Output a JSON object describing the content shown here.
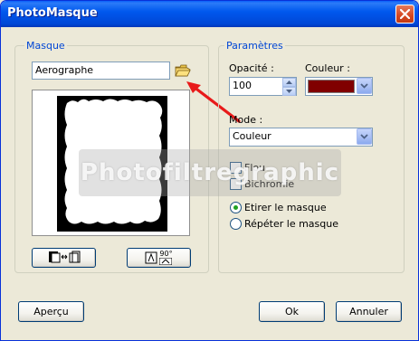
{
  "window": {
    "title": "PhotoMasque",
    "close_icon": "close-icon"
  },
  "masque": {
    "group_label": "Masque",
    "file_value": "Aerographe",
    "open_icon": "open-folder-icon",
    "flip_icon": "flip-horizontal-icon",
    "rotate_icon": "rotate-90-icon",
    "rotate_badge": "90°"
  },
  "parametres": {
    "group_label": "Paramètres",
    "opacite_label": "Opacité :",
    "opacite_value": "100",
    "couleur_label": "Couleur :",
    "couleur_value": "#800000",
    "mode_label": "Mode :",
    "mode_value": "Couleur",
    "flou_label": "Flou",
    "flou_checked": false,
    "bichromie_label": "Bichromie",
    "bichromie_checked": false,
    "etirer_label": "Etirer le masque",
    "etirer_checked": true,
    "repeter_label": "Répéter le masque",
    "repeter_checked": false
  },
  "buttons": {
    "apercu": "Aperçu",
    "ok": "Ok",
    "annuler": "Annuler"
  },
  "watermark": "Photofiltregraphic",
  "colors": {
    "accent": "#0046d5",
    "swatch": "#800000",
    "annotation_arrow": "#e81a1a"
  }
}
